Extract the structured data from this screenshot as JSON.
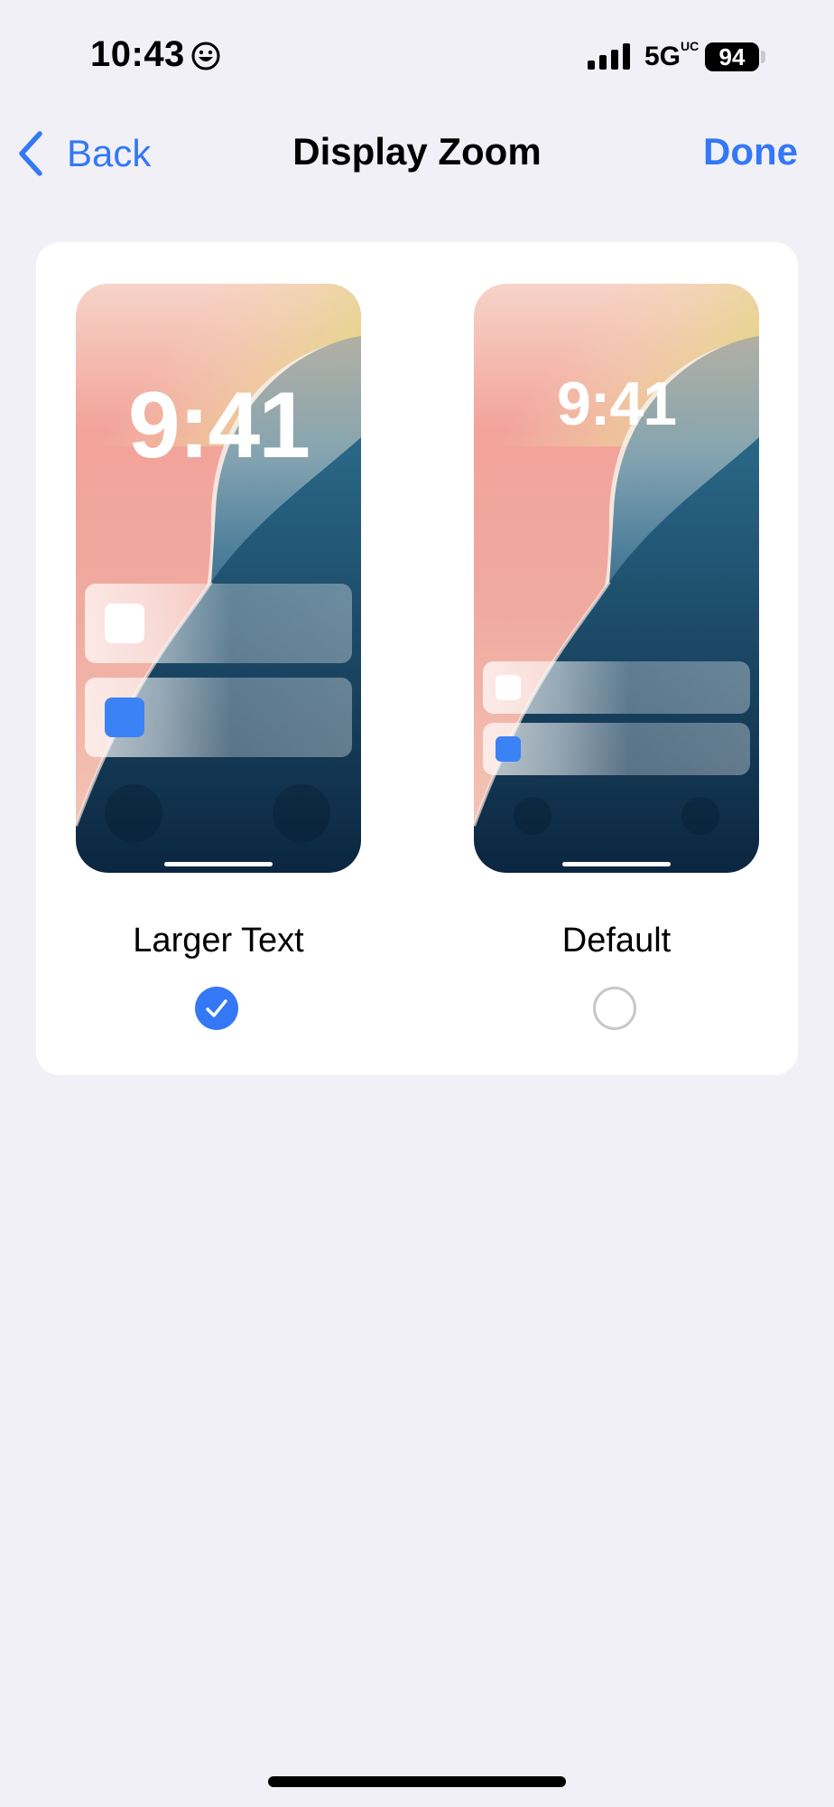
{
  "status_bar": {
    "time": "10:43",
    "network": "5G",
    "network_suffix": "UC",
    "battery": "94",
    "icons": [
      "smiley-icon",
      "cellular-signal-icon",
      "battery-icon"
    ]
  },
  "nav": {
    "back_label": "Back",
    "title": "Display Zoom",
    "done_label": "Done"
  },
  "options": [
    {
      "label": "Larger Text",
      "preview_time": "9:41",
      "selected": true
    },
    {
      "label": "Default",
      "preview_time": "9:41",
      "selected": false
    }
  ],
  "colors": {
    "accent": "#3478f6",
    "background": "#f1f0f6",
    "card": "#ffffff"
  }
}
